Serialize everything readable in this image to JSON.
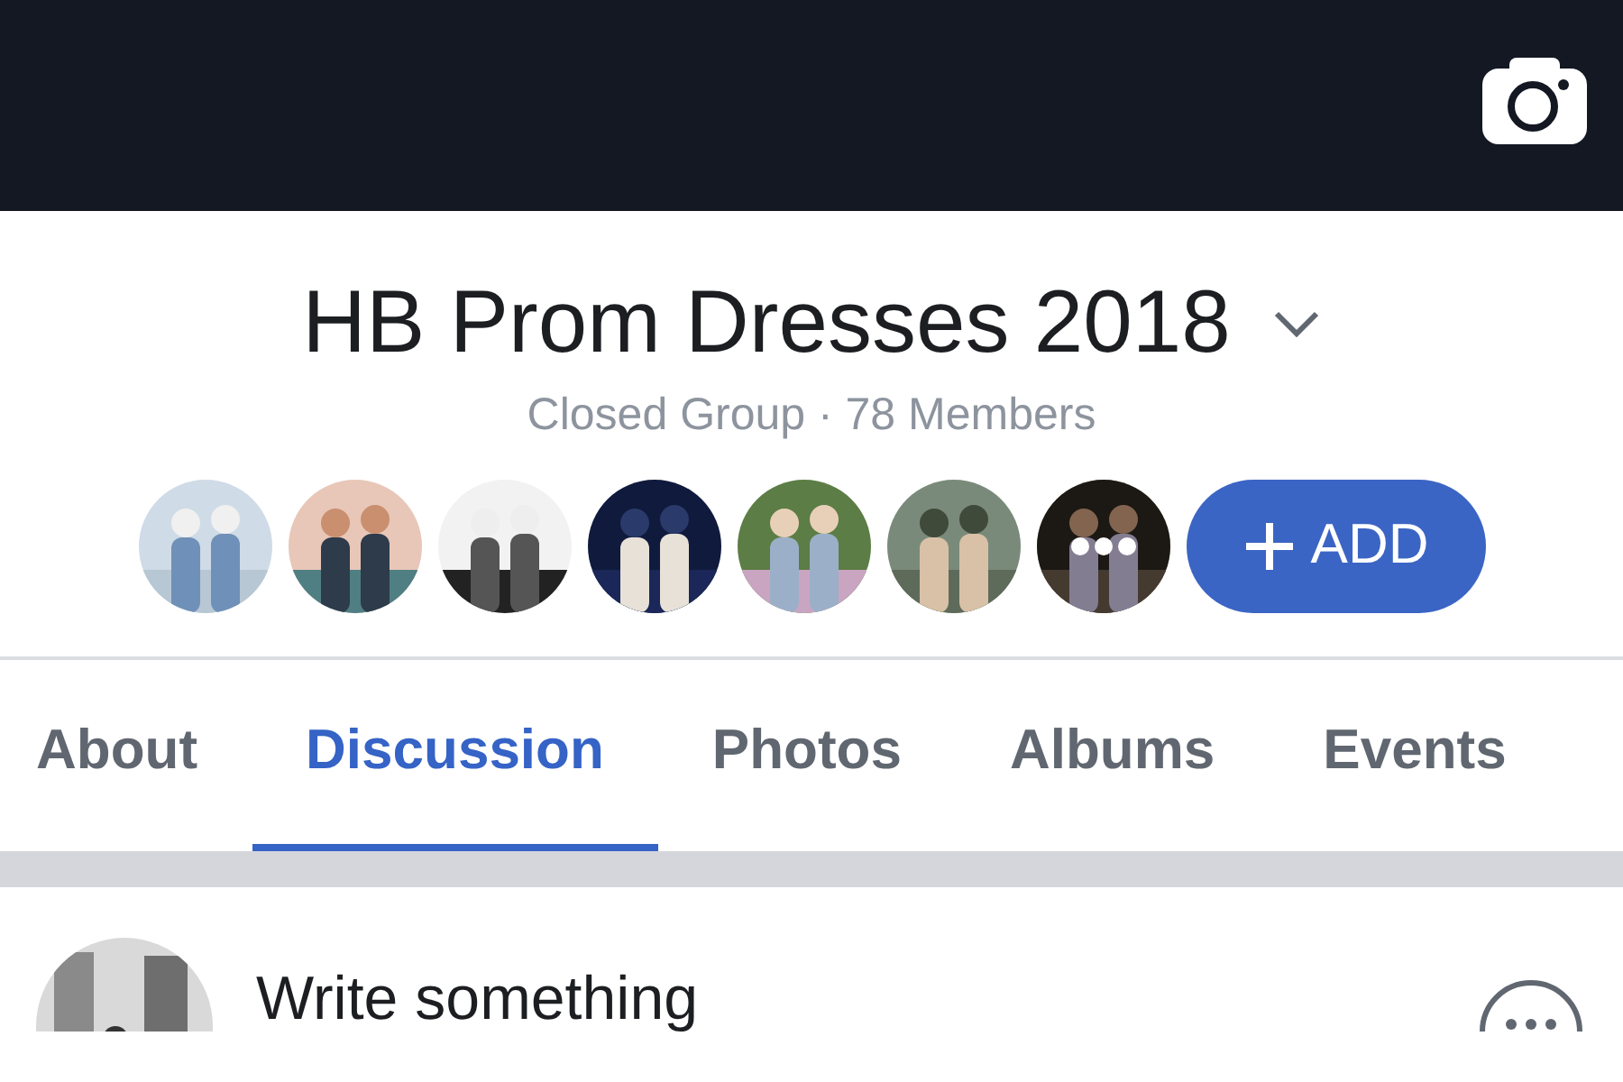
{
  "group": {
    "title": "HB Prom Dresses 2018",
    "subtitle": "Closed Group · 78 Members"
  },
  "member_avatars": [
    {
      "kind": "picture",
      "more": false
    },
    {
      "kind": "picture",
      "more": false
    },
    {
      "kind": "picture",
      "more": false
    },
    {
      "kind": "picture",
      "more": false
    },
    {
      "kind": "picture",
      "more": false
    },
    {
      "kind": "picture",
      "more": false
    },
    {
      "kind": "picture",
      "more": true
    }
  ],
  "add_button": {
    "label": "ADD"
  },
  "tabs": [
    {
      "label": "About",
      "selected": false
    },
    {
      "label": "Discussion",
      "selected": true
    },
    {
      "label": "Photos",
      "selected": false
    },
    {
      "label": "Albums",
      "selected": false
    },
    {
      "label": "Events",
      "selected": false
    }
  ],
  "composer": {
    "placeholder": "Write something"
  }
}
